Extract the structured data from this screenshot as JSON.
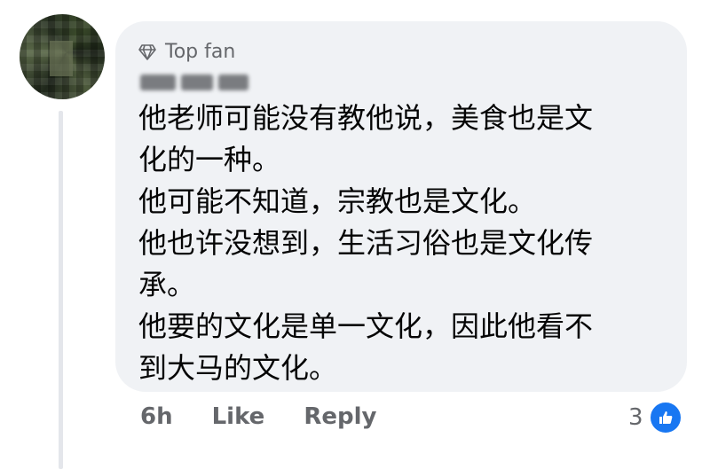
{
  "comment": {
    "badge_label": "Top fan",
    "badge_icon": "diamond-icon",
    "lines": [
      "他老师可能没有教他说，美食也是文",
      "化的一种。",
      "他可能不知道，宗教也是文化。",
      "他也许没想到，生活习俗也是文化传",
      "承。",
      "他要的文化是单一文化，因此他看不",
      "到大马的文化。"
    ]
  },
  "actions": {
    "time": "6h",
    "like_label": "Like",
    "reply_label": "Reply",
    "reaction_count": "3",
    "reaction_icon": "thumbs-up-icon"
  },
  "colors": {
    "bubble": "#f0f2f5",
    "text": "#050505",
    "secondary": "#65676b",
    "like_blue": "#1877f2"
  }
}
